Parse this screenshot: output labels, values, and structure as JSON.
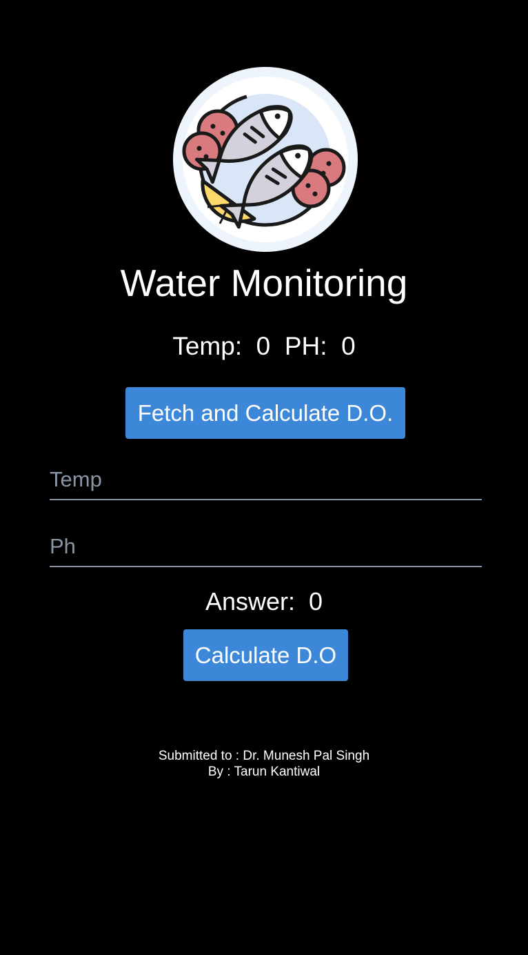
{
  "app": {
    "title": "Water Monitoring",
    "logo_icon": "fish-plate-icon"
  },
  "readings": {
    "temp_label": "Temp:",
    "temp_value": "0",
    "ph_label": "PH:",
    "ph_value": "0"
  },
  "actions": {
    "fetch_label": "Fetch and Calculate D.O.",
    "calculate_label": "Calculate D.O"
  },
  "inputs": {
    "temp": {
      "placeholder": "Temp",
      "value": ""
    },
    "ph": {
      "placeholder": "Ph",
      "value": ""
    }
  },
  "result": {
    "label": "Answer:",
    "value": "0"
  },
  "footer": {
    "submitted_to": "Submitted to : Dr. Munesh Pal Singh",
    "by": "By : Tarun Kantiwal"
  },
  "colors": {
    "background": "#000000",
    "button": "#3d87d8",
    "input_underline": "#8a96a6",
    "text": "#ffffff"
  }
}
